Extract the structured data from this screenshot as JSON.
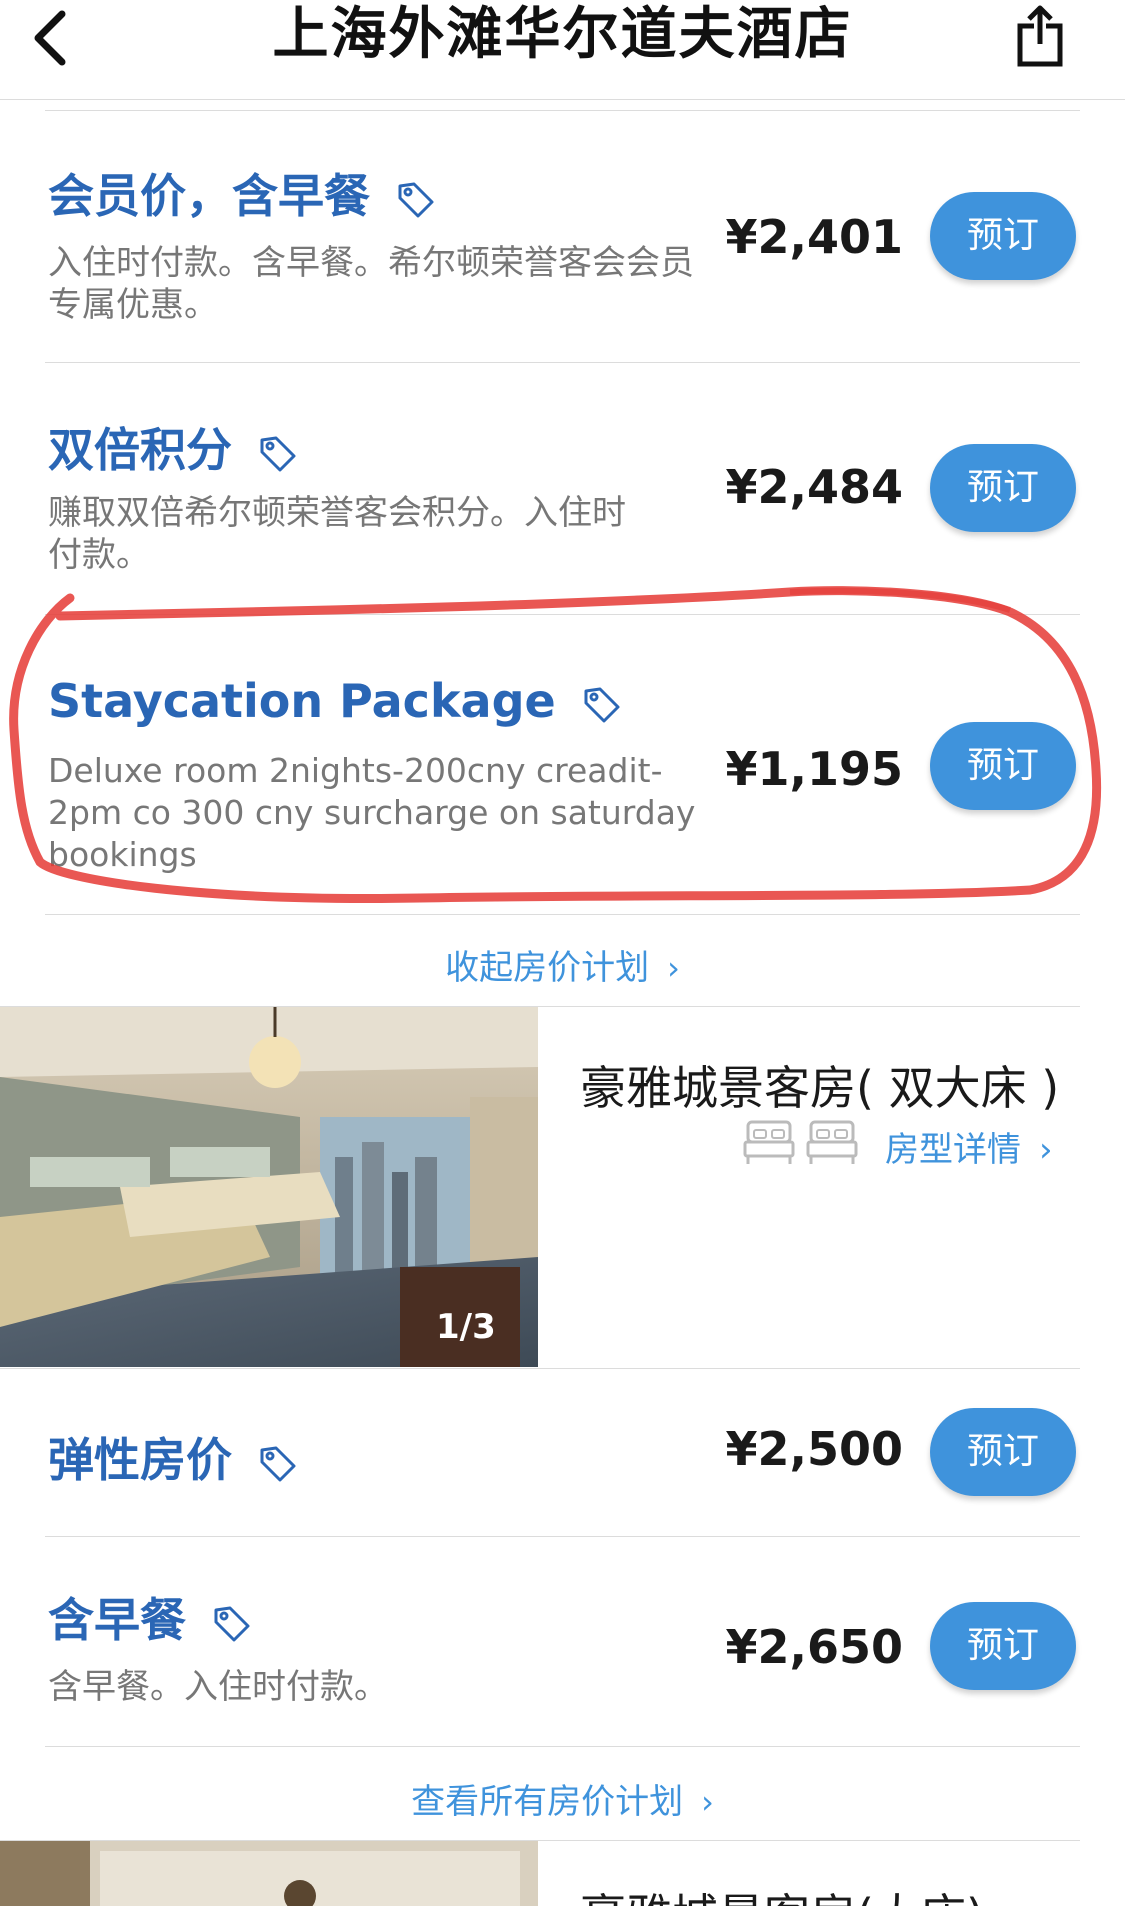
{
  "header": {
    "title": "上海外滩华尔道夫酒店",
    "back_icon": "chevron-left-icon",
    "share_icon": "share-icon"
  },
  "rates_top": [
    {
      "name": "会员价，含早餐",
      "description": "入住时付款。含早餐。希尔顿荣誉客会会员专属优惠。",
      "price": "¥2,401",
      "book_label": "预订"
    },
    {
      "name": "双倍积分",
      "description": "赚取双倍希尔顿荣誉客会积分。入住时付款。",
      "price": "¥2,484",
      "book_label": "预订"
    },
    {
      "name": "Staycation Package",
      "description": "Deluxe room 2nights-200cny creadit-2pm co 300 cny surcharge on saturday bookings",
      "price": "¥1,195",
      "book_label": "预订"
    }
  ],
  "collapse_link": "收起房价计划",
  "room": {
    "name": "豪雅城景客房( 双大床 )",
    "detail_link": "房型详情",
    "image_counter": "1/3",
    "amenity_icons": [
      "bed-icon",
      "bed-icon"
    ]
  },
  "rates_bottom": [
    {
      "name": "弹性房价",
      "price": "¥2,500",
      "book_label": "预订"
    },
    {
      "name": "含早餐",
      "description": "含早餐。入住时付款。",
      "price": "¥2,650",
      "book_label": "预订"
    }
  ],
  "view_all_link": "查看所有房价计划",
  "next_room": {
    "name_partial": "豪雅城景客房(大床)"
  },
  "colors": {
    "accent_blue": "#3f93dc",
    "rate_name_blue": "#2a66b5",
    "annotation_red": "#e53935"
  }
}
